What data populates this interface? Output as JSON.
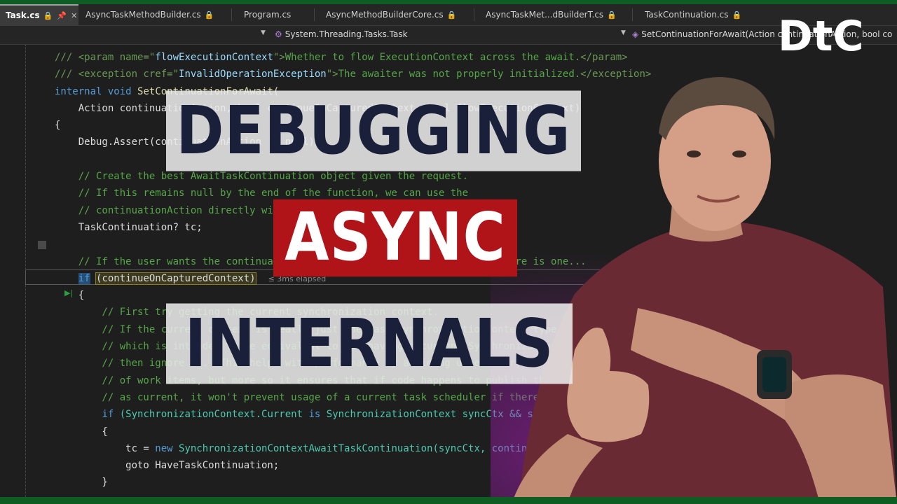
{
  "tabs": [
    {
      "label": "Task.cs",
      "active": true
    },
    {
      "label": "AsyncTaskMethodBuilder.cs",
      "locked": true
    },
    {
      "label": "Program.cs"
    },
    {
      "label": "AsyncMethodBuilderCore.cs",
      "locked": true
    },
    {
      "label": "AsyncTaskMet...dBuilderT.cs",
      "locked": true
    },
    {
      "label": "TaskContinuation.cs",
      "locked": true
    }
  ],
  "navbar": {
    "namespace": "System.Threading.Tasks.Task",
    "method": "SetContinuationForAwait(Action continuationAction, bool co"
  },
  "code": {
    "doc_param_prefix": "/// <param name=\"",
    "doc_param_name": "flowExecutionContext",
    "doc_param_mid": "\">",
    "doc_param_text": "Whether to flow ExecutionContext across the await.",
    "doc_param_close": "</param>",
    "doc_exc_prefix": "/// <exception cref=\"",
    "doc_exc_name": "InvalidOperationException",
    "doc_exc_mid": "\">",
    "doc_exc_text": "The awaiter was not properly initialized.",
    "doc_exc_close": "</exception>",
    "sig_internal": "internal",
    "sig_void": "void",
    "sig_name": "SetContinuationForAwait(",
    "sig_params": "    Action continuationAction, bool continueOnCapturedContext, bool flowExecutionContext)",
    "brace_open": "{",
    "assert": "    Debug.Assert(continuationAction != null);",
    "comment1": "    // Create the best AwaitTaskContinuation object given the request.",
    "comment2": "    // If this remains null by the end of the function, we can use the",
    "comment3": "    // continuationAction directly without wrapping it.",
    "decl": "    TaskContinuation? tc;",
    "comment4": "    // If the user wants the continuation to run on the current context if there is one...",
    "if_kw": "if",
    "if_cond": "(continueOnCapturedContext)",
    "elapsed": "≤ 3ms elapsed",
    "brace2": "    {",
    "c5": "        // First try getting the current synchronization context.",
    "c6": "        // If the current context is really just the base SynchronizationContext type,",
    "c7": "        // which is intended to be equivalent to not having a current SynchronizationContext at all,",
    "c8": "        // then ignore it.  This helps with performance by avoiding unnecessary posts and queueing",
    "c9": "        // of work items, but more so it ensures that if code happens to publish the default context",
    "c10": "        // as current, it won't prevent usage of a current task scheduler if there is one.",
    "if2_kw": "if",
    "if2_rest": "(SynchronizationContext.Current",
    "if2_is": "is",
    "if2_type": "SynchronizationContext syncCtx && syncCtx.GetType() != typeof(SynchronizationContext))",
    "brace3": "        {",
    "tc_assign": "            tc = ",
    "tc_new": "new",
    "tc_rest": " SynchronizationContextAwaitTaskContinuation(syncCtx, continuationAction, flowExecutionContext);",
    "goto": "            goto HaveTaskContinuation;",
    "brace4": "        }"
  },
  "overlay": {
    "line1": "DEBUGGING",
    "line2": "ASYNC",
    "line3": "INTERNALS"
  },
  "logo": {
    "text": "DtC"
  },
  "colors": {
    "accent_red": "#b01318",
    "title_navy": "#1a1f3a",
    "edge_green": "#0e5e24"
  }
}
